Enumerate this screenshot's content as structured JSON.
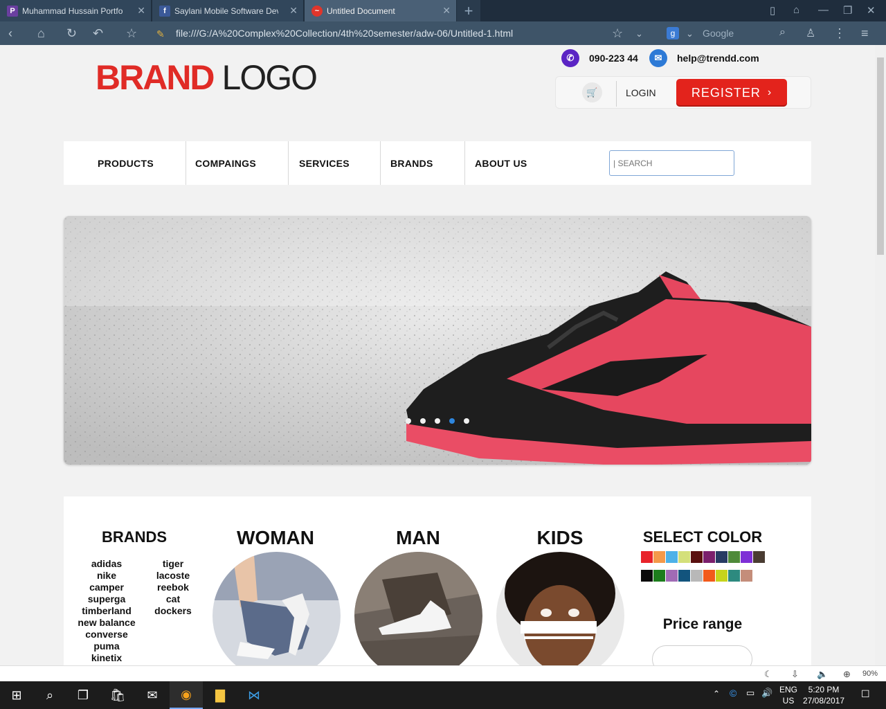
{
  "browser": {
    "tabs": [
      {
        "title": "Muhammad Hussain Portfo",
        "favicon": "P"
      },
      {
        "title": "Saylani Mobile Software Dev",
        "favicon": "f"
      },
      {
        "title": "Untitled Document",
        "favicon": "~"
      }
    ],
    "url": "file:///G:/A%20Complex%20Collection/4th%20semester/adw-06/Untitled-1.html",
    "search_provider": "Google",
    "zoom": "90%"
  },
  "header": {
    "logo_brand": "BRAND",
    "logo_word": "LOGO",
    "phone": "090-223 44",
    "email": "help@trendd.com",
    "login": "LOGIN",
    "register": "REGISTER"
  },
  "nav": {
    "items": [
      "PRODUCTS",
      "COMPAINGS",
      "SERVICES",
      "BRANDS",
      "ABOUT US"
    ],
    "search_placeholder": "| SEARCH"
  },
  "hero": {
    "slides": 5,
    "active_slide": 4
  },
  "categories": {
    "brands_title": "BRANDS",
    "brands_col1": [
      "adidas",
      "nike",
      "camper",
      "superga",
      "timberland",
      "new balance",
      "converse",
      "puma",
      "kinetix"
    ],
    "brands_col2": [
      "tiger",
      "lacoste",
      "reebok",
      "cat",
      "dockers"
    ],
    "woman": "WOMAN",
    "man": "MAN",
    "kids": "KIDS",
    "select_color": "SELECT COLOR",
    "colors": [
      "#e8232a",
      "#f4994a",
      "#4db1e8",
      "#d4e07a",
      "#5a1010",
      "#7b1f6c",
      "#273b63",
      "#4f8a3a",
      "#7e2fd6",
      "#4a3c32",
      "#0b0b0b",
      "#1d7d1d",
      "#a06bb5",
      "#12547d",
      "#b8b8b8",
      "#f25a1a",
      "#c6d41c",
      "#2d8a7f",
      "#c48d7a"
    ],
    "price_range": "Price range"
  },
  "taskbar": {
    "lang": "ENG",
    "region": "US",
    "time": "5:20 PM",
    "date": "27/08/2017"
  }
}
